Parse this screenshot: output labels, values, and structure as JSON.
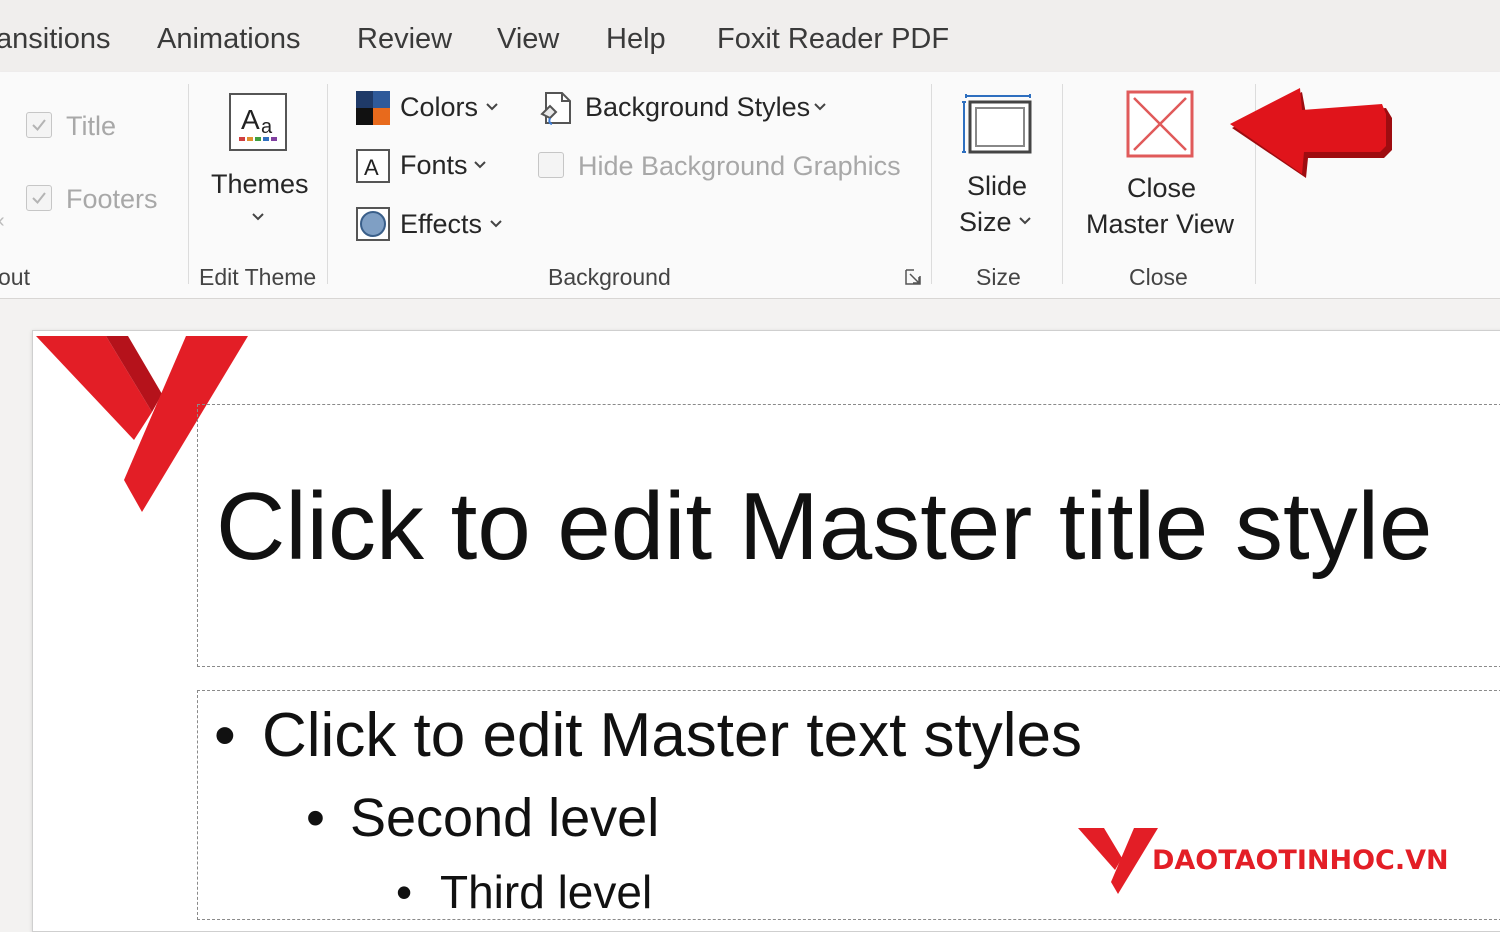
{
  "tabs": [
    "ansitions",
    "Animations",
    "Review",
    "View",
    "Help",
    "Foxit Reader PDF"
  ],
  "ribbon": {
    "master_layout": {
      "title_checkbox": "Title",
      "footers_checkbox": "Footers",
      "group_label": "out"
    },
    "edit_theme": {
      "themes_label": "Themes",
      "group_label": "Edit Theme"
    },
    "background": {
      "colors_label": "Colors",
      "fonts_label": "Fonts",
      "effects_label": "Effects",
      "background_styles_label": "Background Styles",
      "hide_background_graphics_label": "Hide Background Graphics",
      "group_label": "Background"
    },
    "size": {
      "slide_size_line1": "Slide",
      "slide_size_line2": "Size",
      "group_label": "Size"
    },
    "close": {
      "close_line1": "Close",
      "close_line2": "Master View",
      "group_label": "Close"
    }
  },
  "slide": {
    "title": "Click to edit Master title style",
    "level1": "Click to edit Master text styles",
    "level2": "Second level",
    "level3": "Third level"
  },
  "watermark": {
    "text": "DAOTAOTINHOC.VN"
  },
  "colors": {
    "accent_red": "#e31e26",
    "arrow_red": "#e0141b",
    "close_icon_red": "#e05a5a"
  },
  "icons": [
    "check-icon",
    "themes-icon",
    "colors-icon",
    "fonts-icon",
    "effects-icon",
    "background-styles-icon",
    "slide-size-icon",
    "close-master-view-icon",
    "dialog-launcher-icon",
    "chevron-down-icon",
    "red-arrow-icon",
    "logo-icon"
  ]
}
